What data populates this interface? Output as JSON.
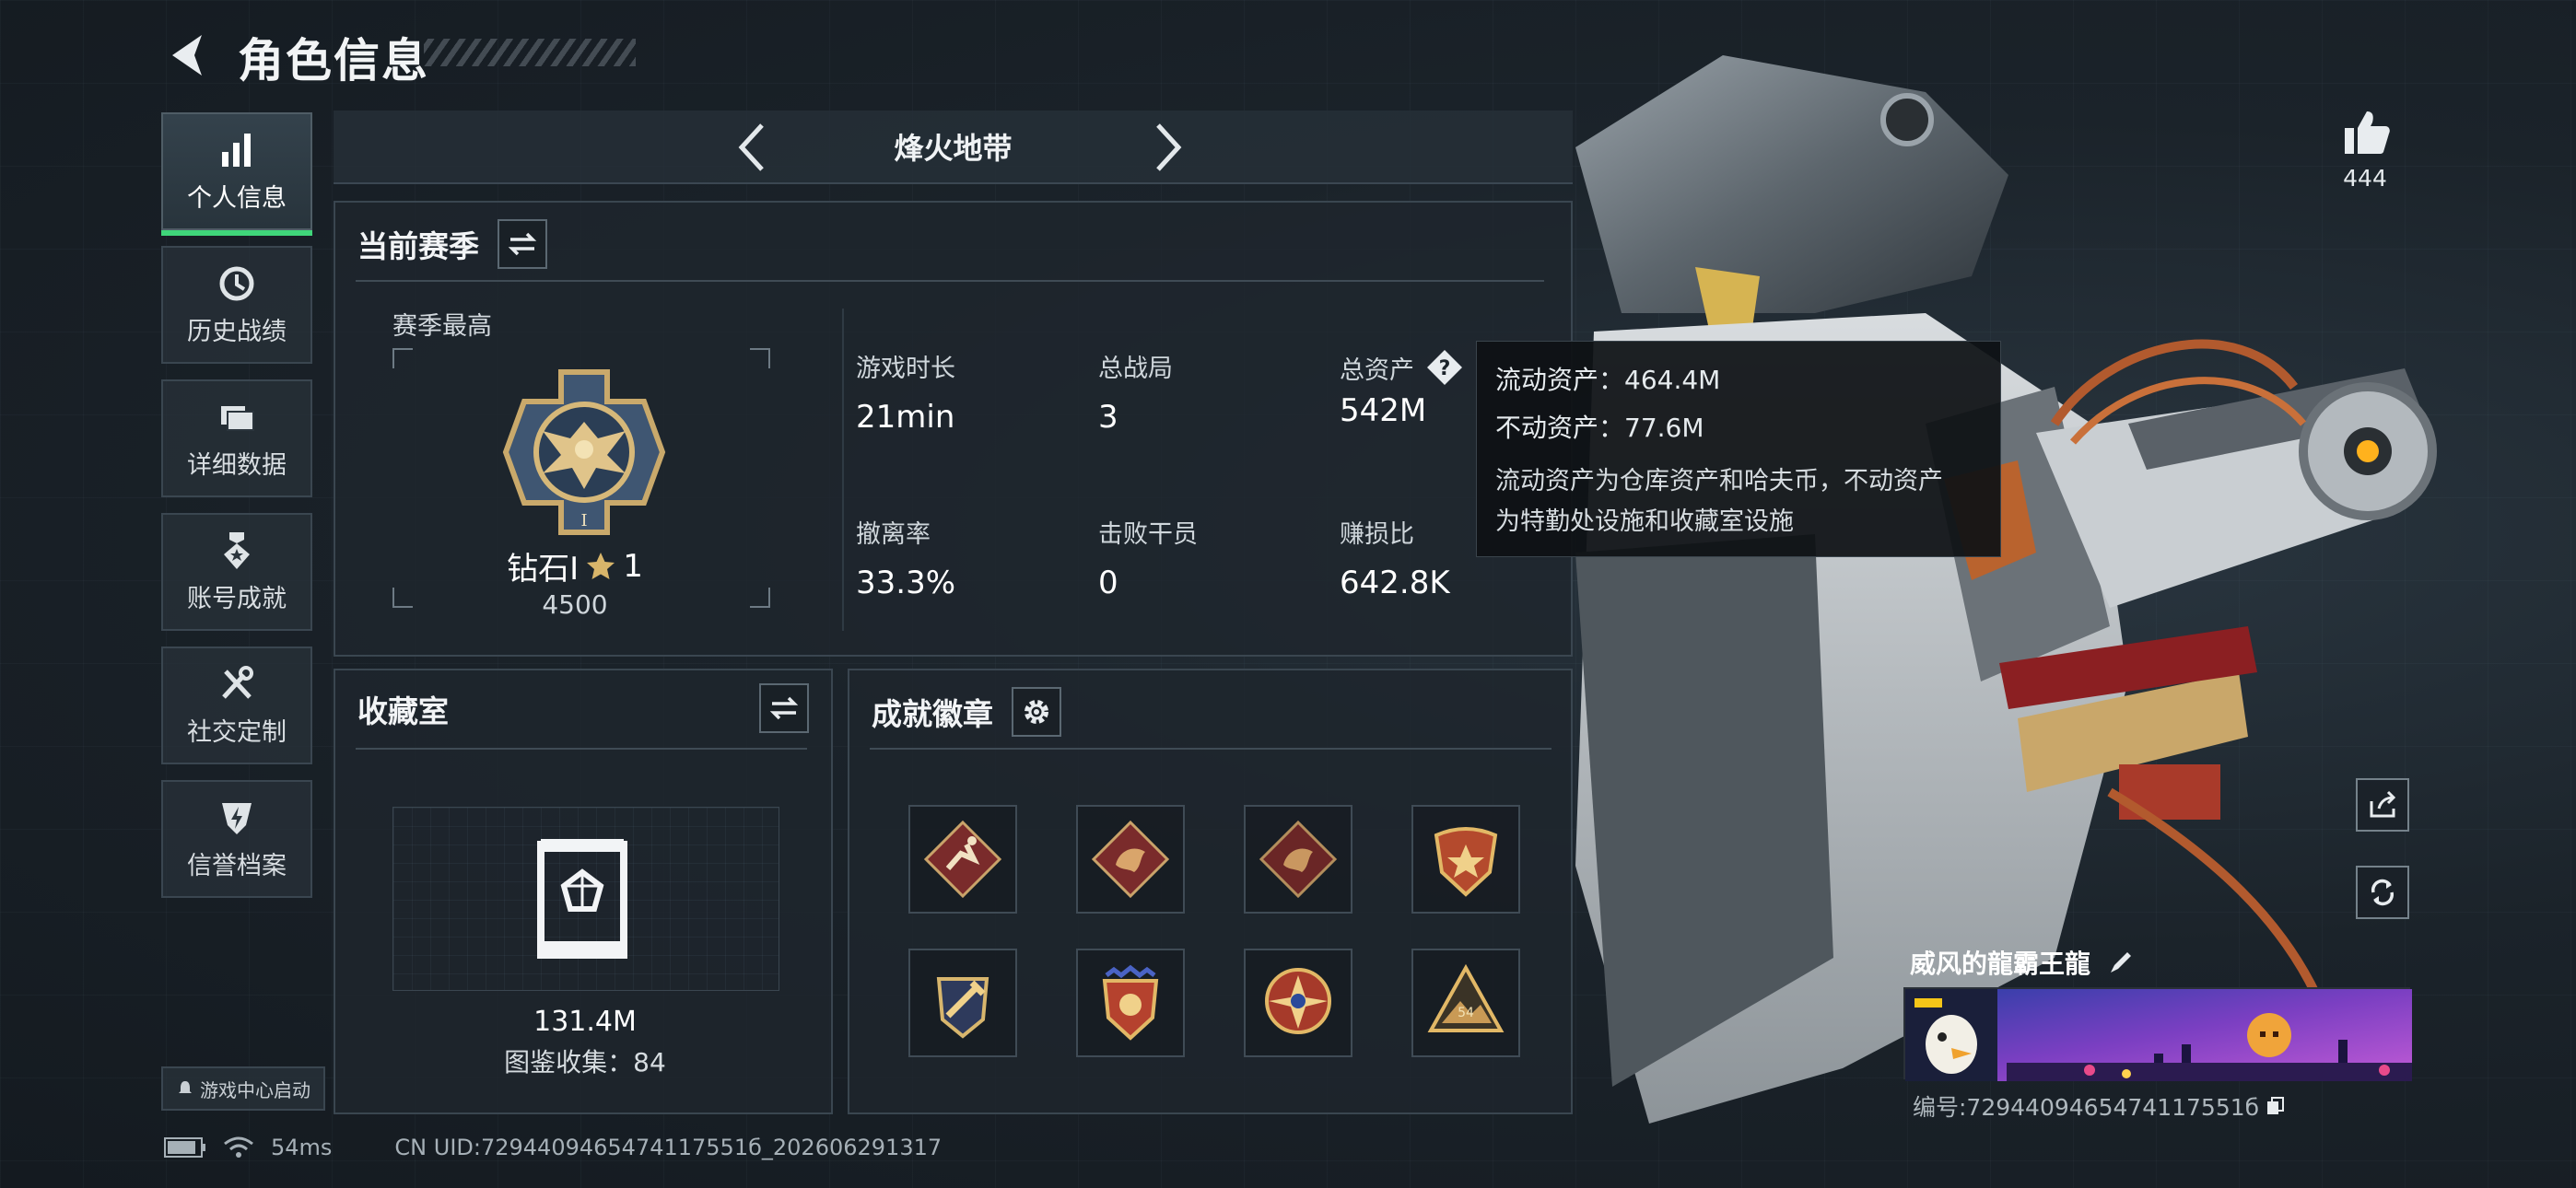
{
  "header": {
    "title": "角色信息"
  },
  "nav": {
    "items": [
      {
        "label": "个人信息",
        "icon": "bar-chart-icon",
        "active": true
      },
      {
        "label": "历史战绩",
        "icon": "history-clock-icon",
        "active": false
      },
      {
        "label": "详细数据",
        "icon": "folder-icon",
        "active": false
      },
      {
        "label": "账号成就",
        "icon": "medal-icon",
        "active": false
      },
      {
        "label": "社交定制",
        "icon": "tools-icon",
        "active": false
      },
      {
        "label": "信誉档案",
        "icon": "shield-bolt-icon",
        "active": false
      }
    ],
    "launch_label": "游戏中心启动"
  },
  "map_selector": {
    "title": "烽火地带"
  },
  "season": {
    "title": "当前赛季",
    "best_label": "赛季最高",
    "rank_name": "钻石Ⅰ",
    "rank_stars": "1",
    "rank_score": "4500",
    "stats": [
      {
        "label": "游戏时长",
        "value": "21min"
      },
      {
        "label": "总战局",
        "value": "3"
      },
      {
        "label": "总资产",
        "value": "542M"
      },
      {
        "label": "撤离率",
        "value": "33.3%"
      },
      {
        "label": "击败干员",
        "value": "0"
      },
      {
        "label": "赚损比",
        "value": "642.8K"
      }
    ]
  },
  "tooltip": {
    "liquid": "流动资产：464.4M",
    "fixed": "不动资产：77.6M",
    "note_1": "流动资产为仓库资产和哈夫币，不动资产",
    "note_2": "为特勤处设施和收藏室设施"
  },
  "collection": {
    "title": "收藏室",
    "value": "131.4M",
    "codex_label": "图鉴收集：84"
  },
  "achievements": {
    "title": "成就徽章",
    "badges": [
      "runner-badge-icon",
      "dragon-badge-icon",
      "dragon-badge-icon",
      "star-shield-badge-icon",
      "hammer-wings-badge-icon",
      "star-shield-badge-icon",
      "compass-star-badge-icon",
      "mountain-54-badge-icon"
    ],
    "badge_texts": [
      "54"
    ]
  },
  "player": {
    "likes": "444",
    "name": "威风的龍霸王龍",
    "id_label": "编号:7294409465474117551б"
  },
  "footer": {
    "ping": "54ms",
    "uid": "CN UID:7294409465474117551б_202606291317"
  },
  "colors": {
    "accent_green": "#3fd67a",
    "tooltip_bg": "#0e1114",
    "panel_bg": "#1e262d"
  }
}
